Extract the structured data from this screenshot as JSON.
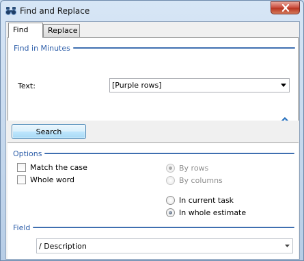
{
  "window": {
    "title": "Find and Replace",
    "app_icon": "binoculars-icon",
    "close_icon": "close-icon"
  },
  "tabs": [
    {
      "label": "Find",
      "active": true
    },
    {
      "label": "Replace",
      "active": false
    }
  ],
  "find_section": {
    "header": "Find in Minutes",
    "text_label": "Text:",
    "text_value": "[Purple rows]",
    "info_icon": "info-icon"
  },
  "search_button": "Search",
  "options": {
    "header": "Options",
    "match_case": {
      "label": "Match the case",
      "checked": false
    },
    "whole_word": {
      "label": "Whole word",
      "checked": false
    },
    "by_rows": {
      "label": "By rows",
      "checked": true,
      "disabled": true
    },
    "by_columns": {
      "label": "By columns",
      "checked": false,
      "disabled": true
    },
    "in_current_task": {
      "label": "In current task",
      "checked": false
    },
    "in_whole_estimate": {
      "label": "In whole estimate",
      "checked": true
    }
  },
  "field_section": {
    "header": "Field",
    "value": "/ Description"
  },
  "colors": {
    "accent": "#3f6fb0",
    "header_text": "#2d5ea9",
    "close_red": "#c8493a"
  }
}
